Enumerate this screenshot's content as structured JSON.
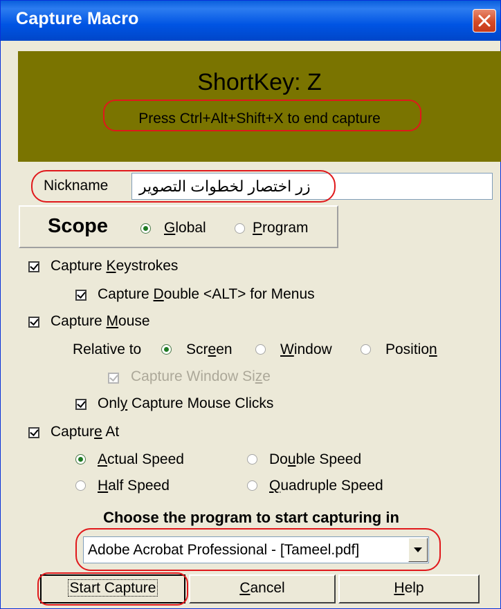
{
  "window": {
    "title": "Capture Macro"
  },
  "header": {
    "shortkey": "ShortKey: Z",
    "message": "Press Ctrl+Alt+Shift+X to end capture",
    "background_color": "#7a7400"
  },
  "nickname": {
    "label": "Nickname",
    "value": "زر اختصار لخطوات التصوير"
  },
  "scope": {
    "title": "Scope",
    "options": [
      {
        "label": "Global",
        "selected": true
      },
      {
        "label": "Program",
        "selected": false
      }
    ]
  },
  "options": {
    "capture_keystrokes": {
      "label": "Capture Keystrokes",
      "checked": true
    },
    "capture_double_alt": {
      "label": "Capture Double <ALT> for Menus",
      "checked": true
    },
    "capture_mouse": {
      "label": "Capture Mouse",
      "checked": true
    },
    "relative_to": {
      "label": "Relative to",
      "options": [
        {
          "label": "Screen",
          "selected": true
        },
        {
          "label": "Window",
          "selected": false
        },
        {
          "label": "Position",
          "selected": false
        }
      ]
    },
    "capture_window_size": {
      "label": "Capture Window Size",
      "checked": true,
      "disabled": true
    },
    "only_mouse_clicks": {
      "label": "Only Capture Mouse Clicks",
      "checked": true
    },
    "capture_at": {
      "label": "Capture At",
      "checked": true,
      "speeds": [
        {
          "label": "Actual Speed",
          "selected": true
        },
        {
          "label": "Double Speed",
          "selected": false
        },
        {
          "label": "Half Speed",
          "selected": false
        },
        {
          "label": "Quadruple Speed",
          "selected": false
        }
      ]
    }
  },
  "program": {
    "label": "Choose the program to start capturing in",
    "selected": "Adobe Acrobat Professional - [Tameel.pdf]"
  },
  "buttons": {
    "start": "Start Capture",
    "cancel": "Cancel",
    "help": "Help"
  },
  "icons": {
    "close": "close-icon",
    "dropdown": "chevron-down-icon"
  },
  "colors": {
    "accent": "#0054e3",
    "highlight_circle": "#e0181b",
    "close_button": "#d54b26"
  }
}
